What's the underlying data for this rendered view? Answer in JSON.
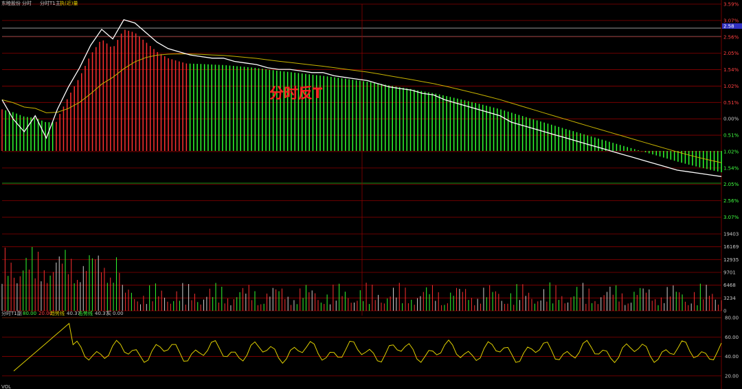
{
  "header": {
    "top": [
      "东睦股份",
      "分时",
      "分时T1主",
      "执(近)量"
    ],
    "sub": [
      "分时T1副",
      "80.00",
      "20.00",
      "趋势线",
      "40.37",
      "击势线",
      "40.37",
      "买",
      "0.00"
    ],
    "bottom": "VOL"
  },
  "annotation": "分时反T",
  "tags": {
    "ref_price": "2.58",
    "vol_flag": "80.00"
  },
  "colors": {
    "bg": "#000000",
    "grid": "#8b0000",
    "price_line": "#ffffff",
    "avg_line": "#c8b400",
    "up_bar": "#ff3030",
    "down_bar": "#30ff30",
    "osc_line": "#e0d000",
    "pos_label": "#ff4040",
    "neg_label": "#40ff40",
    "annotation": "#ff2020"
  },
  "chart_data": [
    {
      "type": "line",
      "title": "",
      "y_ticks": [
        "3.59%",
        "3.07%",
        "2.56%",
        "2.05%",
        "1.54%",
        "1.02%",
        "0.51%",
        "0.00%",
        "0.51%",
        "1.02%",
        "1.54%",
        "2.05%",
        "2.56%",
        "3.07%"
      ],
      "ylim": [
        -3.07,
        3.59
      ],
      "series": [
        {
          "values": [
            0.6,
            0.0,
            -0.4,
            0.1,
            -0.6,
            0.3,
            1.0,
            1.6,
            2.3,
            2.8,
            2.5,
            3.1,
            3.0,
            2.7,
            2.4,
            2.2,
            2.1,
            2.0,
            1.95,
            1.9,
            1.9,
            1.8,
            1.75,
            1.7,
            1.6,
            1.55,
            1.55,
            1.5,
            1.45,
            1.45,
            1.35,
            1.3,
            1.25,
            1.2,
            1.1,
            1.0,
            0.95,
            0.9,
            0.8,
            0.75,
            0.6,
            0.5,
            0.4,
            0.3,
            0.2,
            0.1,
            -0.1,
            -0.2,
            -0.3,
            -0.4,
            -0.5,
            -0.6,
            -0.7,
            -0.8,
            -0.9,
            -1.0,
            -1.1,
            -1.2,
            -1.3,
            -1.4,
            -1.5,
            -1.6,
            -1.65,
            -1.7,
            -1.75,
            -1.8
          ]
        }
      ]
    },
    {
      "type": "bar",
      "title": "",
      "y_ticks": [
        "19403",
        "16169",
        "12935",
        "9701",
        "6468",
        "3234",
        "0"
      ],
      "ylim": [
        0,
        19403
      ]
    },
    {
      "type": "line",
      "title": "",
      "y_ticks": [
        "80.00",
        "60.00",
        "40.00",
        "20.00"
      ],
      "ylim": [
        10,
        80
      ]
    }
  ]
}
